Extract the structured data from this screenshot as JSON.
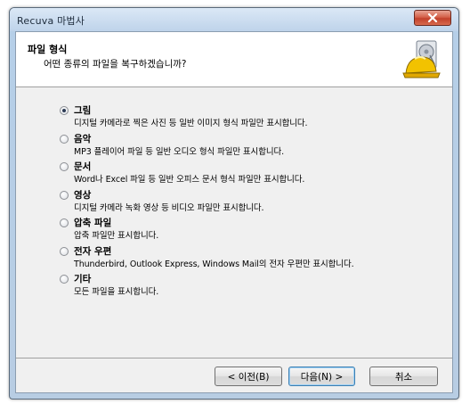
{
  "window": {
    "title": "Recuva 마법사"
  },
  "header": {
    "title": "파일 형식",
    "subtitle": "어떤 종류의 파일을 복구하겠습니까?"
  },
  "options": [
    {
      "label": "그림",
      "description": "디지털 카메라로 찍은 사진 등 일반 이미지 형식 파일만 표시합니다.",
      "checked": true
    },
    {
      "label": "음악",
      "description": "MP3 플레이어 파일 등 일반 오디오 형식 파일만 표시합니다.",
      "checked": false
    },
    {
      "label": "문서",
      "description": "Word나 Excel 파일 등 일반 오피스 문서 형식 파일만 표시합니다.",
      "checked": false
    },
    {
      "label": "영상",
      "description": "디지털 카메라 녹화 영상 등 비디오 파일만 표시합니다.",
      "checked": false
    },
    {
      "label": "압축 파일",
      "description": "압축 파일만 표시합니다.",
      "checked": false
    },
    {
      "label": "전자 우편",
      "description": "Thunderbird, Outlook Express, Windows Mail의 전자 우편만 표시합니다.",
      "checked": false
    },
    {
      "label": "기타",
      "description": "모든 파일을 표시합니다.",
      "checked": false
    }
  ],
  "footer": {
    "back_label": "< 이전(B)",
    "next_label": "다음(N) >",
    "cancel_label": "취소"
  },
  "colors": {
    "title_bar": "#c9dff2",
    "close_button": "#c2412b",
    "icon_accent": "#f2c200"
  },
  "icons": {
    "close": "close-icon",
    "wizard": "recuva-hard-hat-icon"
  }
}
